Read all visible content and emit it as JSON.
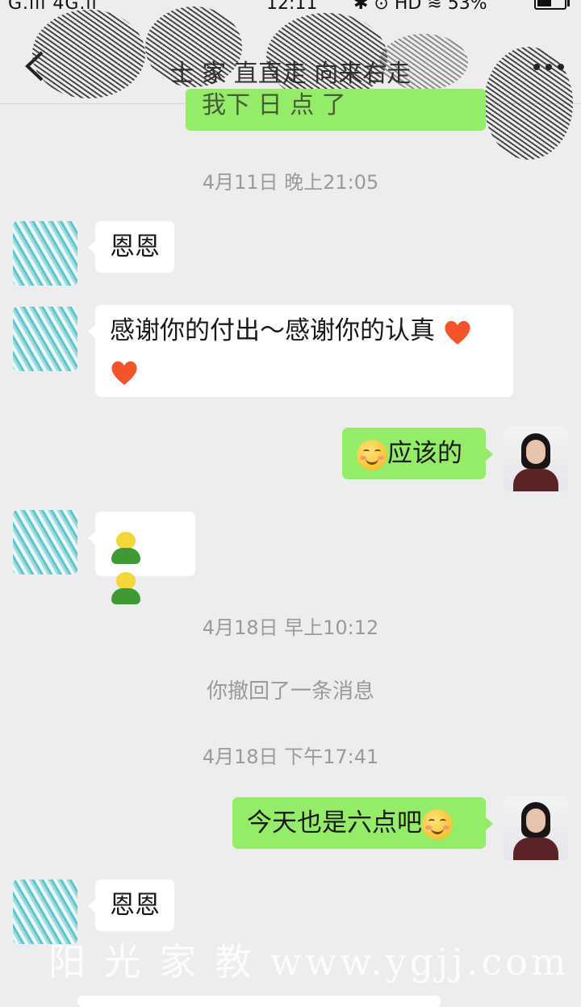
{
  "status_bar": {
    "left": "G.ııl 4G.ıl",
    "time": "12:11",
    "right": "HD",
    "battery": "53%",
    "battery_level": 0.53
  },
  "header": {
    "title": "士 家 直直走 向来右走"
  },
  "partial_message": "我下 日 点 了",
  "messages": {
    "ts1": "4月11日 晚上21:05",
    "m1": "恩恩",
    "m2": "感谢你的付出～感谢你的认真",
    "m3": "应该的",
    "ts2": "4月18日 早上10:12",
    "system": "你撤回了一条消息",
    "ts3": "4月18日 下午17:41",
    "m5": "今天也是六点吧",
    "m6": "恩恩"
  },
  "watermark": "阳 光 家 教  www.ygjj.com",
  "icons": {
    "heart": "heart-emoji",
    "smile": "smiling-face-emoji",
    "sprout": "green-sprout-emoji"
  }
}
